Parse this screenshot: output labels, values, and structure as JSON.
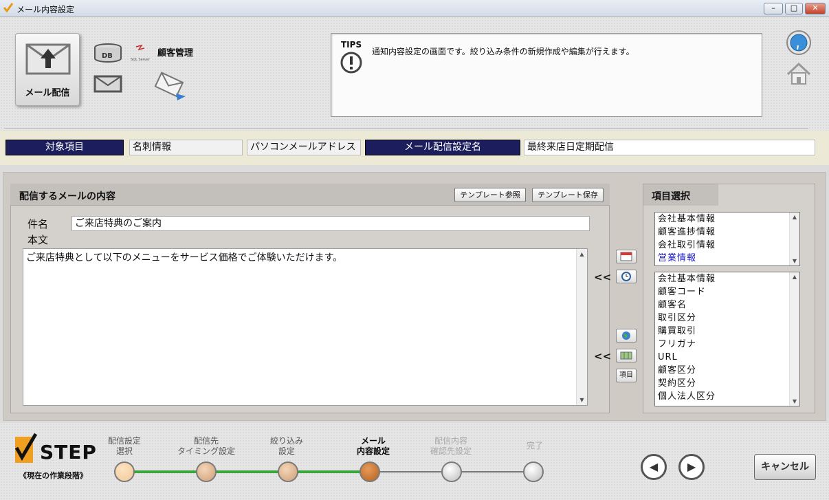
{
  "window": {
    "title": "メール内容設定",
    "min": "–",
    "max": "□",
    "close": "✕"
  },
  "header": {
    "mail_tile_label": "メール配信",
    "db_label": "DB",
    "sql_label": "SQL Server",
    "customer_label": "顧客管理",
    "tips": {
      "label": "TIPS",
      "text": "通知内容設定の画面です。絞り込み条件の新規作成や編集が行えます。"
    }
  },
  "info": {
    "target_label": "対象項目",
    "target_value1": "名刺情報",
    "target_value2": "パソコンメールアドレス",
    "setting_name_label": "メール配信設定名",
    "setting_name_value": "最終来店日定期配信"
  },
  "mail_panel": {
    "title": "配信するメールの内容",
    "template_ref_button": "テンプレート参照",
    "template_save_button": "テンプレート保存",
    "subject_label": "件名",
    "subject_value": "ご来店特典のご案内",
    "body_label": "本文",
    "body_value": "ご来店特典として以下のメニューをサービス価格でご体験いただけます。"
  },
  "middle": {
    "insert1": "<<",
    "insert2": "<<",
    "item_button": "項目"
  },
  "item_panel": {
    "title": "項目選択",
    "categories": [
      "会社基本情報",
      "顧客進捗情報",
      "会社取引情報",
      "営業情報"
    ],
    "selected_category": "営業情報",
    "fields": [
      "会社基本情報",
      "顧客コード",
      "顧客名",
      "取引区分",
      "購買取引",
      "フリガナ",
      "URL",
      "顧客区分",
      "契約区分",
      "個人法人区分"
    ]
  },
  "step": {
    "logo": "STEP",
    "caption": "《現在の作業段階》",
    "steps": [
      {
        "l1": "配信設定",
        "l2": "選択",
        "state": "done"
      },
      {
        "l1": "配信先",
        "l2": "タイミング設定",
        "state": "done"
      },
      {
        "l1": "絞り込み",
        "l2": "設定",
        "state": "done"
      },
      {
        "l1": "メール",
        "l2": "内容設定",
        "state": "current"
      },
      {
        "l1": "配信内容",
        "l2": "確認先設定",
        "state": "todo"
      },
      {
        "l1": "完了",
        "l2": "",
        "state": "todo"
      }
    ],
    "prev": "◀",
    "next": "▶",
    "cancel": "キャンセル"
  },
  "colors": {
    "navy": "#1b1d5c",
    "selected_text": "#1a1acc",
    "step_done": "#f2c89a",
    "step_current": "#b5621e",
    "progress_line": "#3aa53a"
  }
}
